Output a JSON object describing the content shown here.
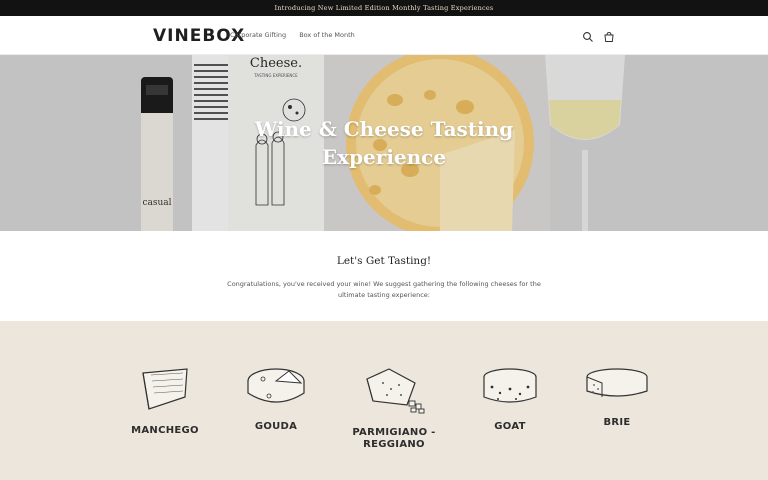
{
  "announcement": {
    "text": "Introducing New Limited Edition Monthly Tasting Experiences"
  },
  "header": {
    "logo": "VINEBOX",
    "nav": [
      "Corporate Gifting",
      "Box of the Month"
    ],
    "icons": [
      "search-icon",
      "cart-icon"
    ]
  },
  "hero": {
    "title": "Wine & Cheese Tasting Experience",
    "box_title": "Cheese.",
    "box_subtitle": "TASTING EXPERIENCE",
    "bottle_label": "casual"
  },
  "intro": {
    "heading": "Let's Get Tasting!",
    "body": "Congratulations, you've received your wine! We suggest gathering the following cheeses for the ultimate tasting experience:"
  },
  "cheeses": [
    {
      "name": "MANCHEGO",
      "icon": "manchego-icon"
    },
    {
      "name": "GOUDA",
      "icon": "gouda-icon"
    },
    {
      "name": "PARMIGIANO -REGGIANO",
      "icon": "parmigiano-icon"
    },
    {
      "name": "GOAT",
      "icon": "goat-cheese-icon"
    },
    {
      "name": "BRIE",
      "icon": "brie-icon"
    }
  ],
  "colors": {
    "announcement_bg": "#121212",
    "section_bg": "#ece6dd",
    "cheese_yellow": "#f1c877"
  }
}
